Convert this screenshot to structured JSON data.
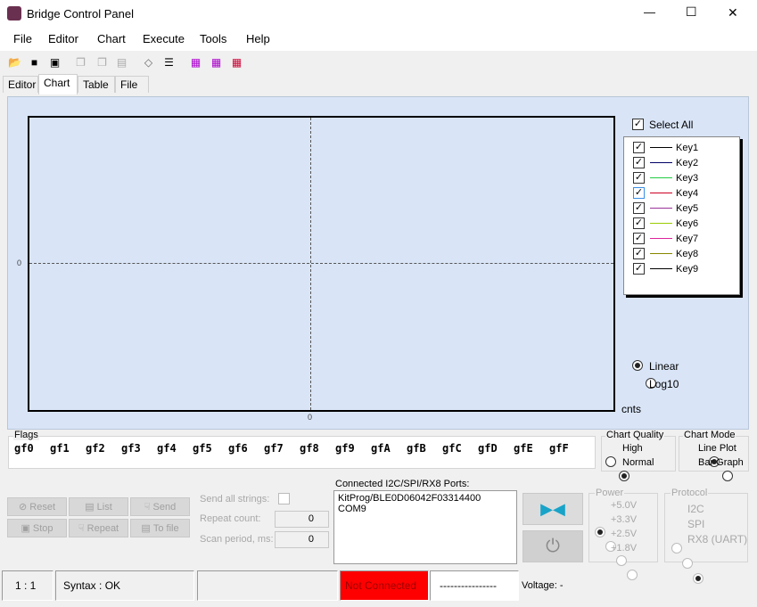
{
  "window": {
    "title": "Bridge Control Panel",
    "minimize": "—",
    "maximize": "☐",
    "close": "✕"
  },
  "menu": [
    "File",
    "Editor",
    "Chart",
    "Execute",
    "Tools",
    "Help"
  ],
  "toolbar": [
    "open-icon",
    "save-icon",
    "save-as-icon",
    "copy-doc-icon",
    "copy-icon",
    "paste-icon",
    "eraser-icon",
    "list-icon",
    "chart-line-icon",
    "chart-scope-icon",
    "chart-wave-icon"
  ],
  "tabs": [
    "Editor",
    "Chart",
    "Table",
    "File"
  ],
  "active_tab": "Chart",
  "chart": {
    "y_zero": "0",
    "x_zero": "0",
    "unit": "cnts",
    "select_all": "Select All",
    "keys": [
      {
        "label": "Key1",
        "color": "#000000"
      },
      {
        "label": "Key2",
        "color": "#000066"
      },
      {
        "label": "Key3",
        "color": "#22cc44"
      },
      {
        "label": "Key4",
        "color": "#cc0022"
      },
      {
        "label": "Key5",
        "color": "#993399"
      },
      {
        "label": "Key6",
        "color": "#99cc00"
      },
      {
        "label": "Key7",
        "color": "#dd2299"
      },
      {
        "label": "Key8",
        "color": "#888800"
      },
      {
        "label": "Key9",
        "color": "#000000"
      }
    ],
    "scale": {
      "linear": "Linear",
      "log": "Log10",
      "selected": "Linear"
    }
  },
  "flags": {
    "label": "Flags",
    "items": [
      "gf0",
      "gf1",
      "gf2",
      "gf3",
      "gf4",
      "gf5",
      "gf6",
      "gf7",
      "gf8",
      "gf9",
      "gfA",
      "gfB",
      "gfC",
      "gfD",
      "gfE",
      "gfF"
    ]
  },
  "chart_quality": {
    "label": "Chart Quality",
    "high": "High",
    "normal": "Normal",
    "selected": "Normal"
  },
  "chart_mode": {
    "label": "Chart Mode",
    "line": "Line Plot",
    "bar": "Bar Graph",
    "selected": "Line Plot"
  },
  "buttons": {
    "reset": "Reset",
    "list": "List",
    "send": "Send",
    "stop": "Stop",
    "repeat": "Repeat",
    "tofile": "To file"
  },
  "send_all": "Send all strings:",
  "repeat_count": {
    "label": "Repeat count:",
    "value": "0"
  },
  "scan_period": {
    "label": "Scan period, ms:",
    "value": "0"
  },
  "ports": {
    "label": "Connected I2C/SPI/RX8 Ports:",
    "items": [
      "KitProg/BLE0D06042F03314400",
      "COM9"
    ]
  },
  "power": {
    "label": "Power",
    "options": [
      "+5.0V",
      "+3.3V",
      "+2.5V",
      "+1.8V"
    ],
    "selected": "+5.0V"
  },
  "protocol": {
    "label": "Protocol",
    "options": [
      "I2C",
      "SPI",
      "RX8 (UART)"
    ],
    "selected": "RX8 (UART)"
  },
  "status": {
    "position": "1 : 1",
    "syntax": "Syntax : OK",
    "connection": "Not Connected",
    "connection_color": "#ff0000",
    "dashes": "----------------",
    "voltage": "Voltage: -"
  }
}
